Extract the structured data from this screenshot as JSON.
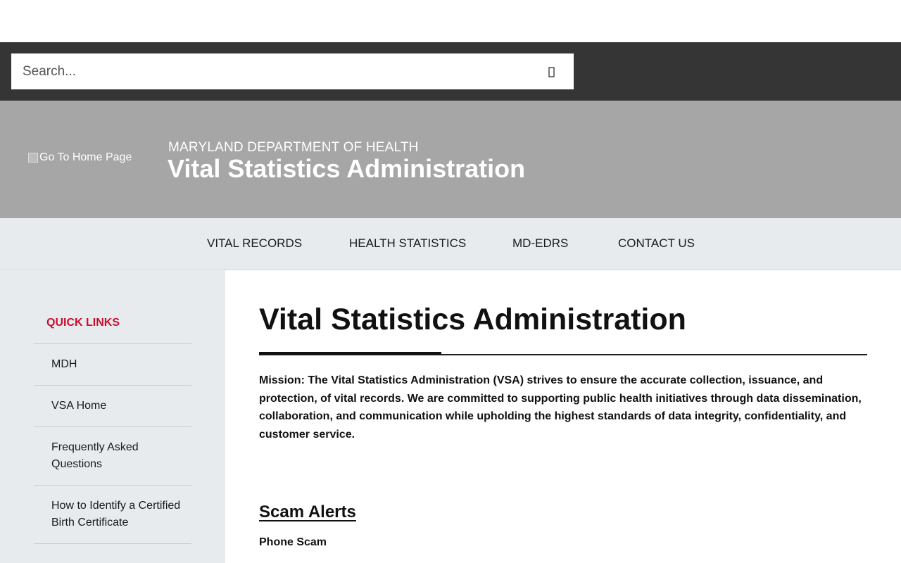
{
  "search": {
    "placeholder": "Search..."
  },
  "header": {
    "logo_alt": "Go To Home Page",
    "department": "MARYLAND DEPARTMENT OF HEALTH",
    "site_title": "Vital Statistics Administration"
  },
  "nav": {
    "items": [
      {
        "label": "VITAL RECORDS"
      },
      {
        "label": "HEALTH STATISTICS"
      },
      {
        "label": "MD-EDRS"
      },
      {
        "label": "CONTACT US"
      }
    ]
  },
  "sidebar": {
    "title": "QUICK LINKS",
    "items": [
      {
        "label": "MDH"
      },
      {
        "label": "VSA Home"
      },
      {
        "label": "Frequently Asked Questions"
      },
      {
        "label": "How to Identify a Certified Birth Certificate"
      }
    ]
  },
  "main": {
    "title": "Vital Statistics Administration",
    "mission": "Mission: The Vital Statistics Administration (VSA) strives to ensure the accurate collection, issuance, and protection, of vital records. We are committed to supporting public health initiatives through data dissemination, collaboration, and communication while upholding the highest standards of data integrity, confidentiality, and customer service.",
    "scam_heading": "Scam Alerts",
    "scam_subheading": "Phone Scam"
  },
  "colors": {
    "search_bar_bg": "#353535",
    "banner_bg": "#a6a6a6",
    "nav_bg": "#e8ebee",
    "quick_links_accent": "#c8102e"
  },
  "icons": {
    "search": "search-icon",
    "logo": "broken-image-icon"
  }
}
